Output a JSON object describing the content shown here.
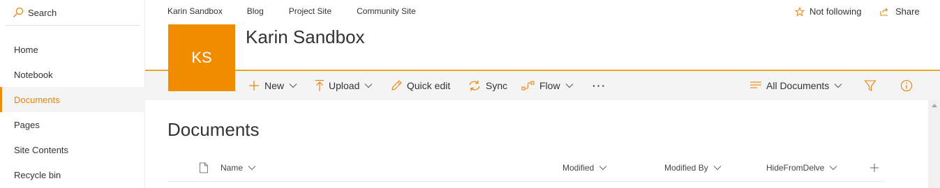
{
  "search": {
    "label": "Search"
  },
  "leftnav": {
    "items": [
      {
        "label": "Home"
      },
      {
        "label": "Notebook"
      },
      {
        "label": "Documents"
      },
      {
        "label": "Pages"
      },
      {
        "label": "Site Contents"
      },
      {
        "label": "Recycle bin"
      }
    ],
    "active_index": 2
  },
  "topnav": {
    "links": [
      "Karin Sandbox",
      "Blog",
      "Project Site",
      "Community Site"
    ]
  },
  "actions": {
    "follow_label": "Not following",
    "share_label": "Share"
  },
  "site": {
    "logo_initials": "KS",
    "title": "Karin Sandbox"
  },
  "commandbar": {
    "new_label": "New",
    "upload_label": "Upload",
    "quickedit_label": "Quick edit",
    "sync_label": "Sync",
    "flow_label": "Flow",
    "more_label": "···",
    "view_label": "All Documents"
  },
  "library": {
    "title": "Documents",
    "columns": [
      "Name",
      "Modified",
      "Modified By",
      "HideFromDelve"
    ]
  },
  "colors": {
    "accent": "#f08c00",
    "nav_active_text": "#e8830c",
    "command_bar_bg": "#f4f4f4"
  },
  "icons": [
    "search-icon",
    "star-icon",
    "share-icon",
    "plus-icon",
    "upload-icon",
    "pencil-icon",
    "sync-icon",
    "flow-icon",
    "view-list-icon",
    "filter-icon",
    "info-icon",
    "document-icon",
    "add-column-icon"
  ]
}
